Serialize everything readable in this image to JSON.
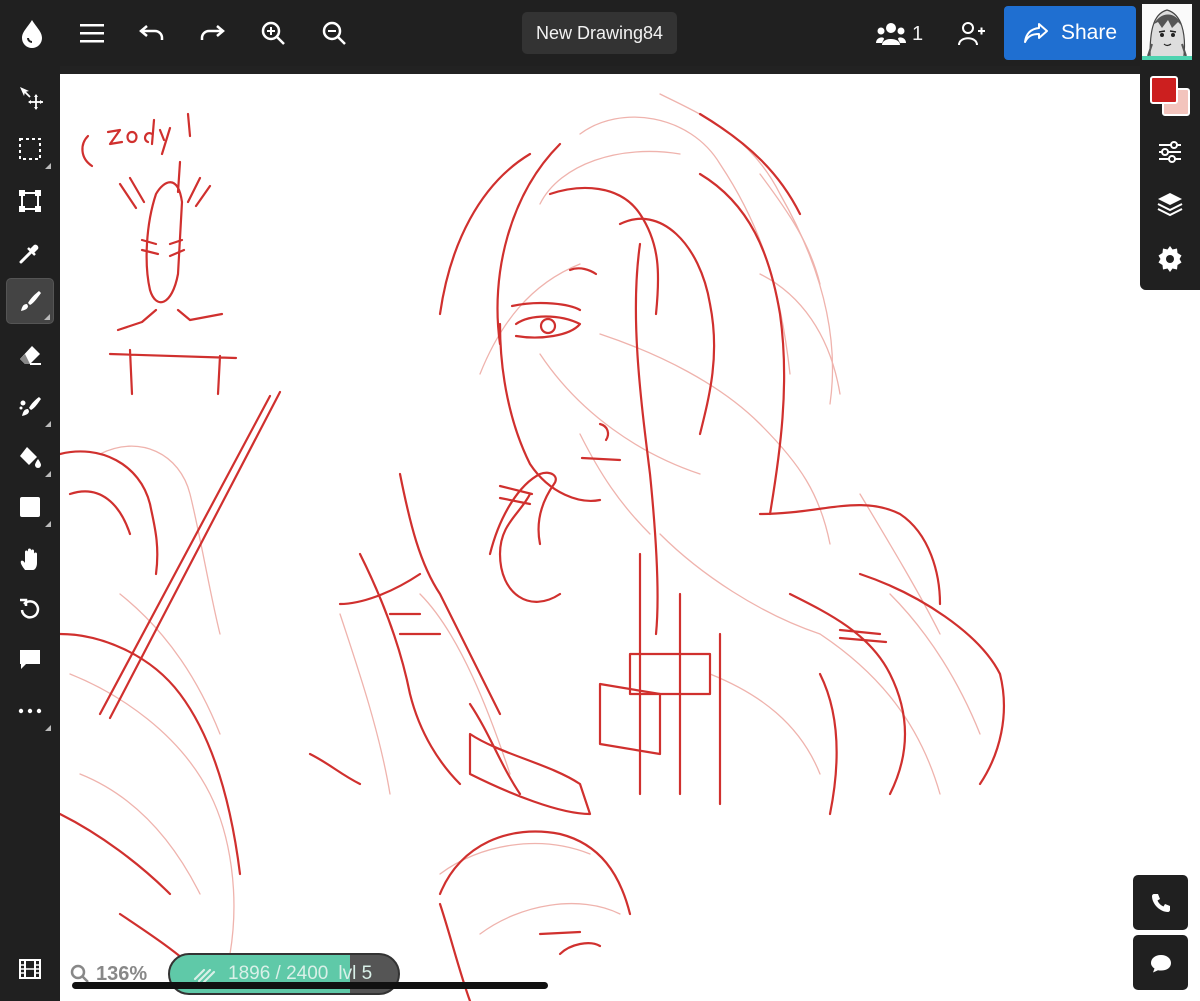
{
  "header": {
    "title": "New Drawing84",
    "users_count": "1",
    "share_label": "Share",
    "icons": [
      "logo-drop-icon",
      "menu-icon",
      "undo-icon",
      "redo-icon",
      "zoom-in-icon",
      "zoom-out-icon",
      "users-icon",
      "add-user-icon",
      "share-arrow-icon",
      "avatar"
    ]
  },
  "tools": [
    {
      "name": "move-tool",
      "icon": "move-icon",
      "has_submenu": false
    },
    {
      "name": "select-tool",
      "icon": "marquee-icon",
      "has_submenu": true
    },
    {
      "name": "transform-tool",
      "icon": "transform-icon",
      "has_submenu": false
    },
    {
      "name": "eyedropper-tool",
      "icon": "eyedropper-icon",
      "has_submenu": false
    },
    {
      "name": "brush-tool",
      "icon": "brush-icon",
      "has_submenu": true,
      "active": true
    },
    {
      "name": "eraser-tool",
      "icon": "eraser-icon",
      "has_submenu": false
    },
    {
      "name": "smudge-tool",
      "icon": "smudge-icon",
      "has_submenu": true
    },
    {
      "name": "fill-tool",
      "icon": "paint-bucket-icon",
      "has_submenu": true
    },
    {
      "name": "shape-tool",
      "icon": "square-icon",
      "has_submenu": true
    },
    {
      "name": "hand-tool",
      "icon": "hand-icon",
      "has_submenu": false
    },
    {
      "name": "rotate-tool",
      "icon": "rotate-icon",
      "has_submenu": false
    },
    {
      "name": "comment-tool",
      "icon": "comment-icon",
      "has_submenu": false
    },
    {
      "name": "more-tools",
      "icon": "more-icon",
      "has_submenu": true
    }
  ],
  "colors": {
    "primary": "#cc1f1f",
    "secondary": "#f3c4bd",
    "accent": "#1f6fd1",
    "progress": "#5fc9a8",
    "sketch": "#d0302e"
  },
  "right_panel": [
    "color-swatch",
    "adjust-icon",
    "layers-icon",
    "settings-icon"
  ],
  "status": {
    "zoom": "136%",
    "progress_text": "1896 / 2400",
    "level": "lvl 5",
    "progress_fraction": 0.79
  },
  "canvas": {
    "sketch_text": "zodyl"
  },
  "bottom_right": [
    "phone-icon",
    "chat-icon"
  ]
}
